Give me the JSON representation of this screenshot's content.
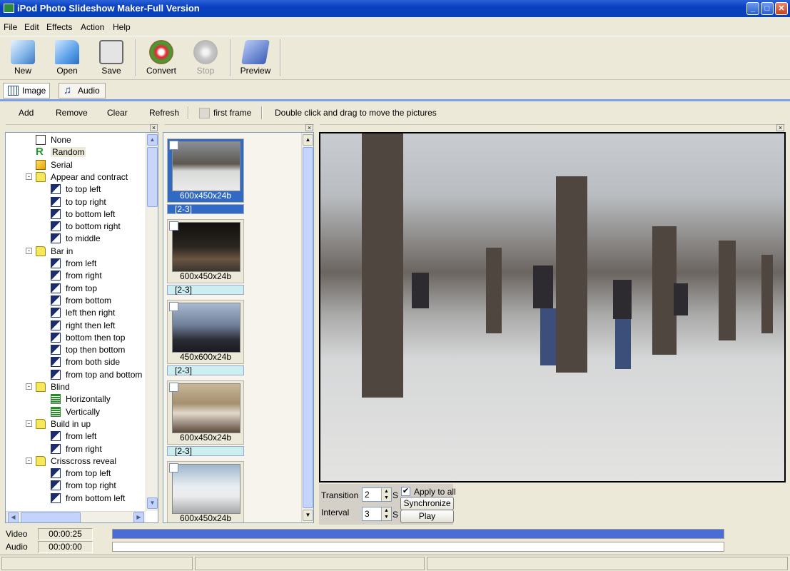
{
  "window": {
    "title": "iPod Photo Slideshow Maker-Full Version"
  },
  "menu": [
    "File",
    "Edit",
    "Effects",
    "Action",
    "Help"
  ],
  "toolbar": {
    "new": "New",
    "open": "Open",
    "save": "Save",
    "convert": "Convert",
    "stop": "Stop",
    "preview": "Preview"
  },
  "tabs": {
    "image": "Image",
    "audio": "Audio"
  },
  "actions": {
    "add": "Add",
    "remove": "Remove",
    "clear": "Clear",
    "refresh": "Refresh",
    "first_frame": "first frame",
    "hint": "Double click and drag to move the pictures"
  },
  "effects_tree": [
    {
      "label": "None",
      "level": 0,
      "icon": "none-icon"
    },
    {
      "label": "Random",
      "level": 0,
      "icon": "random-icon",
      "selected": true
    },
    {
      "label": "Serial",
      "level": 0,
      "icon": "serial-icon"
    },
    {
      "label": "Appear and contract",
      "level": 0,
      "icon": "folder-icon",
      "expander": "-"
    },
    {
      "label": "to top left",
      "level": 1,
      "icon": "effect-icon"
    },
    {
      "label": "to top right",
      "level": 1,
      "icon": "effect-icon"
    },
    {
      "label": "to bottom left",
      "level": 1,
      "icon": "effect-icon"
    },
    {
      "label": "to bottom right",
      "level": 1,
      "icon": "effect-icon"
    },
    {
      "label": "to middle",
      "level": 1,
      "icon": "effect-icon"
    },
    {
      "label": "Bar in",
      "level": 0,
      "icon": "folder-icon",
      "expander": "-"
    },
    {
      "label": "from left",
      "level": 1,
      "icon": "effect-icon"
    },
    {
      "label": "from right",
      "level": 1,
      "icon": "effect-icon"
    },
    {
      "label": "from top",
      "level": 1,
      "icon": "effect-icon"
    },
    {
      "label": "from bottom",
      "level": 1,
      "icon": "effect-icon"
    },
    {
      "label": "left then right",
      "level": 1,
      "icon": "effect-icon"
    },
    {
      "label": "right then left",
      "level": 1,
      "icon": "effect-icon"
    },
    {
      "label": "bottom then top",
      "level": 1,
      "icon": "effect-icon"
    },
    {
      "label": "top then bottom",
      "level": 1,
      "icon": "effect-icon"
    },
    {
      "label": "from both side",
      "level": 1,
      "icon": "effect-icon"
    },
    {
      "label": "from top and bottom",
      "level": 1,
      "icon": "effect-icon"
    },
    {
      "label": "Blind",
      "level": 0,
      "icon": "folder-icon",
      "expander": "-"
    },
    {
      "label": "Horizontally",
      "level": 1,
      "icon": "blind-icon"
    },
    {
      "label": "Vertically",
      "level": 1,
      "icon": "blind-icon"
    },
    {
      "label": "Build in up",
      "level": 0,
      "icon": "folder-icon",
      "expander": "-"
    },
    {
      "label": "from left",
      "level": 1,
      "icon": "effect-icon"
    },
    {
      "label": "from right",
      "level": 1,
      "icon": "effect-icon"
    },
    {
      "label": "Crisscross reveal",
      "level": 0,
      "icon": "folder-icon",
      "expander": "-"
    },
    {
      "label": "from top left",
      "level": 1,
      "icon": "effect-icon"
    },
    {
      "label": "from top right",
      "level": 1,
      "icon": "effect-icon"
    },
    {
      "label": "from bottom left",
      "level": 1,
      "icon": "effect-icon"
    }
  ],
  "thumbnails": [
    {
      "size": "600x450x24b",
      "range": "[2-3]",
      "selected": true,
      "palette": "snow"
    },
    {
      "size": "600x450x24b",
      "range": "[2-3]",
      "selected": false,
      "palette": "night"
    },
    {
      "size": "450x600x24b",
      "range": "[2-3]",
      "selected": false,
      "palette": "dusk"
    },
    {
      "size": "600x450x24b",
      "range": "[2-3]",
      "selected": false,
      "palette": "indoor"
    },
    {
      "size": "600x450x24b",
      "range": "",
      "selected": false,
      "palette": "boat"
    }
  ],
  "controls": {
    "transition_label": "Transition",
    "transition_value": "2",
    "transition_unit": "S",
    "interval_label": "Interval",
    "interval_value": "3",
    "interval_unit": "S",
    "apply_all": "Apply to all",
    "apply_all_checked": true,
    "synchronize": "Synchronize",
    "play": "Play"
  },
  "timeline": {
    "video_label": "Video",
    "video_time": "00:00:25",
    "video_fill": 1.0,
    "audio_label": "Audio",
    "audio_time": "00:00:00",
    "audio_fill": 0.0
  },
  "colors": {
    "title_blue": "#0a3fc0",
    "accent": "#316ac5",
    "progress": "#4a6cd4"
  }
}
